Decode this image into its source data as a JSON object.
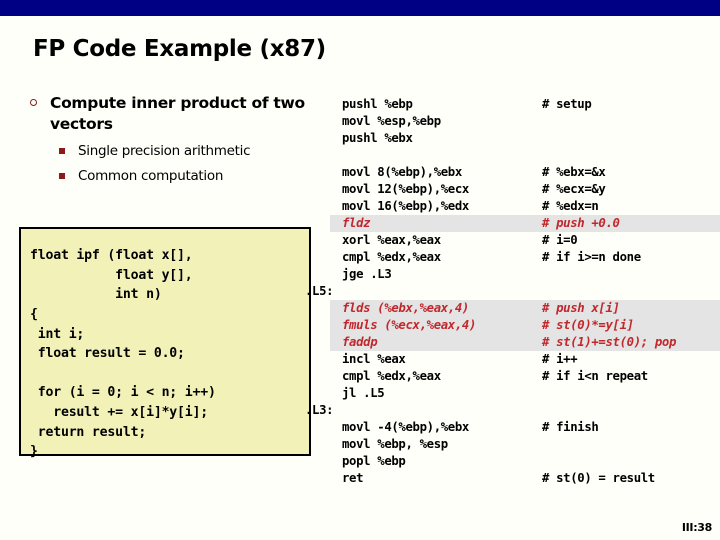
{
  "slide": {
    "title": "FP Code Example (x87)",
    "page_number": "III:38",
    "banner_color": "#000084",
    "background_color": "#fffffa",
    "highlight_color": "#e4e4e4",
    "highlight_text_color": "#c0282d",
    "code_box_color": "#f2f2b8"
  },
  "bullets": {
    "level1": [
      {
        "text": "Compute inner product of two vectors",
        "marker": "hollow-circle",
        "marker_color": "#8b1a1a"
      }
    ],
    "level2": [
      {
        "text": "Single precision arithmetic",
        "marker": "filled-square",
        "marker_color": "#8b1a1a"
      },
      {
        "text": "Common computation",
        "marker": "filled-square",
        "marker_color": "#8b1a1a"
      }
    ]
  },
  "c_code": "float ipf (float x[],\n           float y[],\n           int n)\n{\n int i;\n float result = 0.0;\n\n for (i = 0; i < n; i++)\n   result += x[i]*y[i];\n return result;\n}",
  "assembly": {
    "rows": [
      {
        "label": "",
        "instr": "pushl %ebp",
        "comment": "# setup",
        "highlight": false
      },
      {
        "label": "",
        "instr": "movl %esp,%ebp",
        "comment": "",
        "highlight": false
      },
      {
        "label": "",
        "instr": "pushl %ebx",
        "comment": "",
        "highlight": false
      },
      {
        "label": "",
        "instr": "",
        "comment": "",
        "highlight": false
      },
      {
        "label": "",
        "instr": "movl 8(%ebp),%ebx",
        "comment": "# %ebx=&x",
        "highlight": false
      },
      {
        "label": "",
        "instr": "movl 12(%ebp),%ecx",
        "comment": "# %ecx=&y",
        "highlight": false
      },
      {
        "label": "",
        "instr": "movl 16(%ebp),%edx",
        "comment": "# %edx=n",
        "highlight": false
      },
      {
        "label": "",
        "instr": "fldz",
        "comment": "# push +0.0",
        "highlight": true
      },
      {
        "label": "",
        "instr": "xorl %eax,%eax",
        "comment": "# i=0",
        "highlight": false
      },
      {
        "label": "",
        "instr": "cmpl %edx,%eax",
        "comment": "# if i>=n done",
        "highlight": false
      },
      {
        "label": "",
        "instr": "jge .L3",
        "comment": "",
        "highlight": false
      },
      {
        "label": ".L5:",
        "instr": "",
        "comment": "",
        "highlight": false
      },
      {
        "label": "",
        "instr": "flds (%ebx,%eax,4)",
        "comment": "# push x[i]",
        "highlight": true
      },
      {
        "label": "",
        "instr": "fmuls (%ecx,%eax,4)",
        "comment": "# st(0)*=y[i]",
        "highlight": true
      },
      {
        "label": "",
        "instr": "faddp",
        "comment": "# st(1)+=st(0); pop",
        "highlight": true
      },
      {
        "label": "",
        "instr": "incl %eax",
        "comment": "# i++",
        "highlight": false
      },
      {
        "label": "",
        "instr": "cmpl %edx,%eax",
        "comment": "# if i<n repeat",
        "highlight": false
      },
      {
        "label": "",
        "instr": "jl .L5",
        "comment": "",
        "highlight": false
      },
      {
        "label": ".L3:",
        "instr": "",
        "comment": "",
        "highlight": false
      },
      {
        "label": "",
        "instr": "movl -4(%ebp),%ebx",
        "comment": "# finish",
        "highlight": false
      },
      {
        "label": "",
        "instr": "movl %ebp, %esp",
        "comment": "",
        "highlight": false
      },
      {
        "label": "",
        "instr": "popl %ebp",
        "comment": "",
        "highlight": false
      },
      {
        "label": "",
        "instr": "ret",
        "comment": "# st(0) = result",
        "highlight": false
      }
    ]
  }
}
